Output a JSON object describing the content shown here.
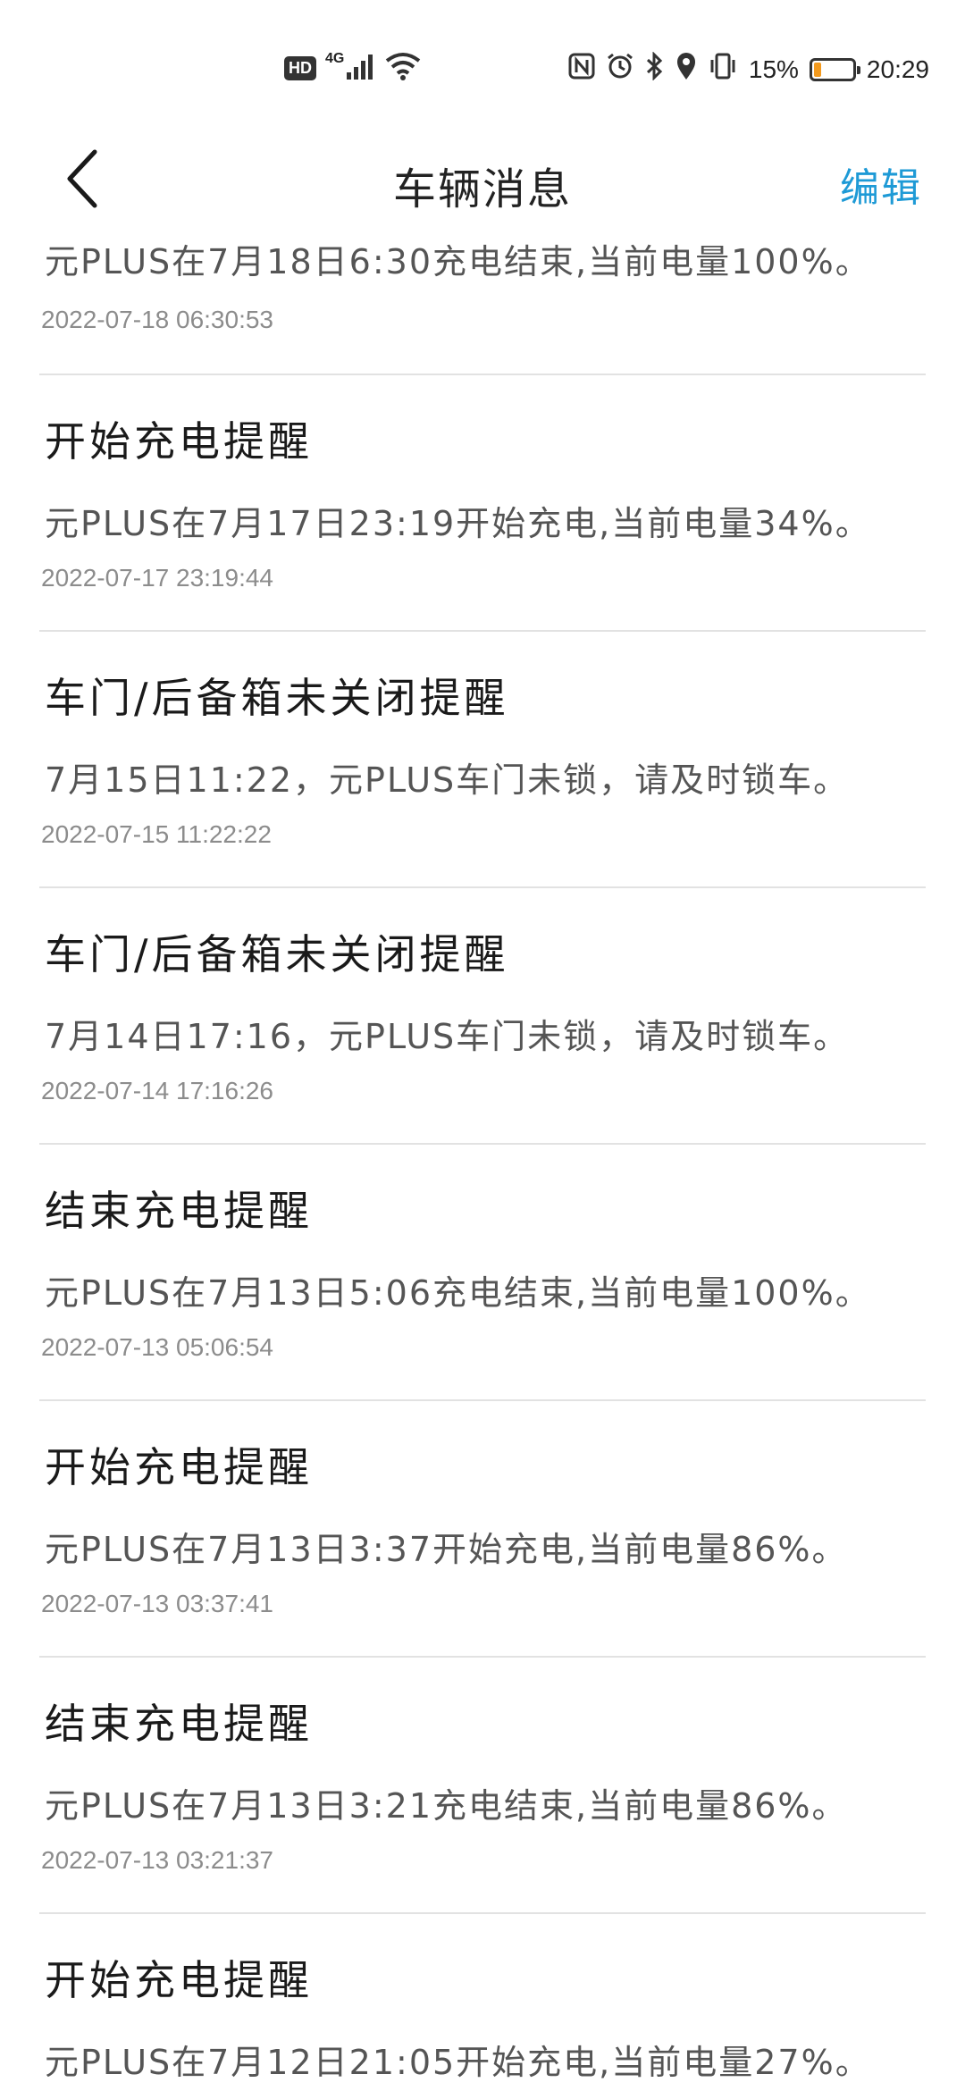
{
  "status_bar": {
    "hd_label": "HD",
    "network_label": "4G",
    "battery_percent": "15%",
    "battery_level": 0.15,
    "time": "20:29",
    "icons": [
      "signal-icon",
      "wifi-icon",
      "nfc-icon",
      "alarm-icon",
      "bluetooth-icon",
      "location-icon",
      "vibrate-icon",
      "battery-icon"
    ]
  },
  "header": {
    "title": "车辆消息",
    "edit_label": "编辑",
    "back_icon": "chevron-left-icon"
  },
  "colors": {
    "accent": "#1e9ad6",
    "title_text": "#1a1a1a",
    "body_text": "#555555",
    "time_text": "#8c8c8c",
    "divider": "#e2e2e2",
    "battery_fill": "#f39a1e"
  },
  "messages": [
    {
      "title": "",
      "body": "元PLUS在7月18日6:30充电结束,当前电量100%。",
      "time": "2022-07-18 06:30:53"
    },
    {
      "title": "开始充电提醒",
      "body": "元PLUS在7月17日23:19开始充电,当前电量34%。",
      "time": "2022-07-17 23:19:44"
    },
    {
      "title": "车门/后备箱未关闭提醒",
      "body": "7月15日11:22，元PLUS车门未锁，请及时锁车。",
      "time": "2022-07-15 11:22:22"
    },
    {
      "title": "车门/后备箱未关闭提醒",
      "body": "7月14日17:16，元PLUS车门未锁，请及时锁车。",
      "time": "2022-07-14 17:16:26"
    },
    {
      "title": "结束充电提醒",
      "body": "元PLUS在7月13日5:06充电结束,当前电量100%。",
      "time": "2022-07-13 05:06:54"
    },
    {
      "title": "开始充电提醒",
      "body": "元PLUS在7月13日3:37开始充电,当前电量86%。",
      "time": "2022-07-13 03:37:41"
    },
    {
      "title": "结束充电提醒",
      "body": "元PLUS在7月13日3:21充电结束,当前电量86%。",
      "time": "2022-07-13 03:21:37"
    },
    {
      "title": "开始充电提醒",
      "body": "元PLUS在7月12日21:05开始充电,当前电量27%。",
      "time": ""
    }
  ]
}
